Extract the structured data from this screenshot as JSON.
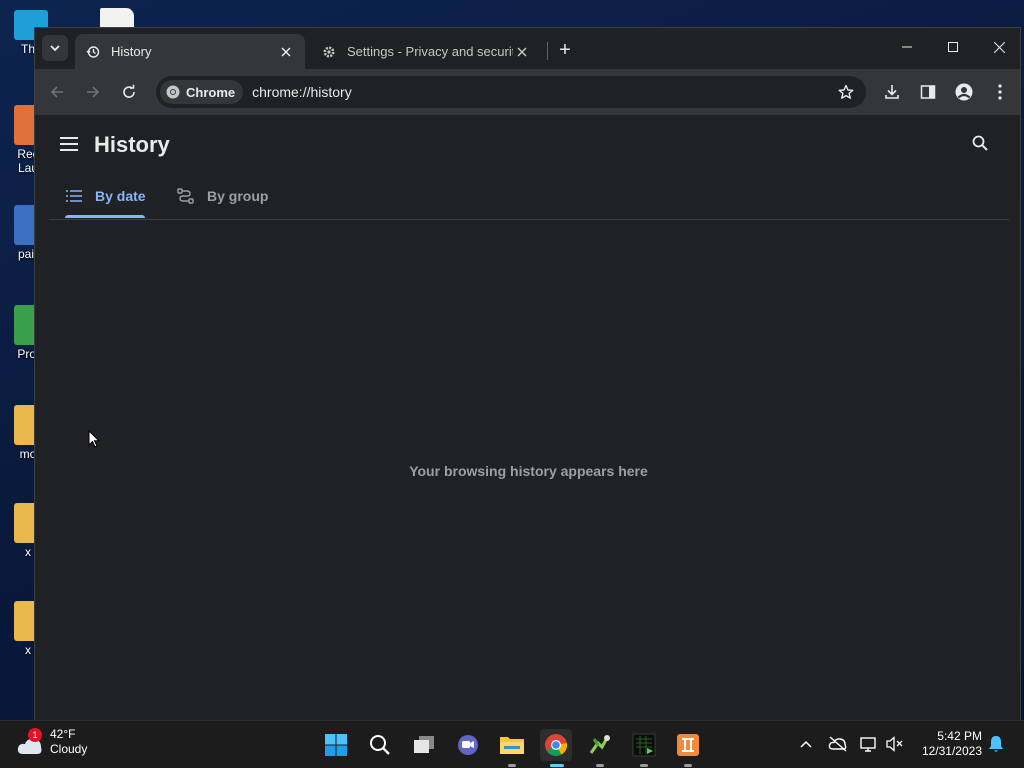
{
  "desktop": {
    "icons": [
      {
        "label": "Th",
        "color": "#1e9fd8"
      },
      {
        "label": "Rec\nLau",
        "color": "#e2703a"
      },
      {
        "label": "pair",
        "color": "#3a6fc4"
      },
      {
        "label": "Proj",
        "color": "#3a9f4a"
      },
      {
        "label": "mo",
        "color": "#e8b84a"
      },
      {
        "label": "x",
        "color": "#e8b84a"
      },
      {
        "label": "x",
        "color": "#e8b84a"
      }
    ]
  },
  "browser": {
    "tabs": [
      {
        "title": "History",
        "icon": "history-icon",
        "active": true
      },
      {
        "title": "Settings - Privacy and security",
        "icon": "gear-icon",
        "active": false
      }
    ],
    "new_tab_label": "+",
    "omnibox": {
      "chip_label": "Chrome",
      "url": "chrome://history"
    }
  },
  "history_page": {
    "title": "History",
    "tabs": [
      {
        "label": "By date",
        "icon": "list-icon",
        "selected": true
      },
      {
        "label": "By group",
        "icon": "group-icon",
        "selected": false
      }
    ],
    "empty_message": "Your browsing history appears here"
  },
  "taskbar": {
    "weather": {
      "temp": "42°F",
      "condition": "Cloudy",
      "badge": "1"
    },
    "apps": [
      "start-icon",
      "search-icon",
      "task-view-icon",
      "chat-icon",
      "file-explorer-icon",
      "chrome-icon",
      "python-icon",
      "terminal-icon",
      "app-icon"
    ],
    "clock": {
      "time": "5:42 PM",
      "date": "12/31/2023"
    }
  },
  "colors": {
    "accent": "#8ab4f8",
    "page_bg": "#202124",
    "toolbar_bg": "#35363a"
  }
}
